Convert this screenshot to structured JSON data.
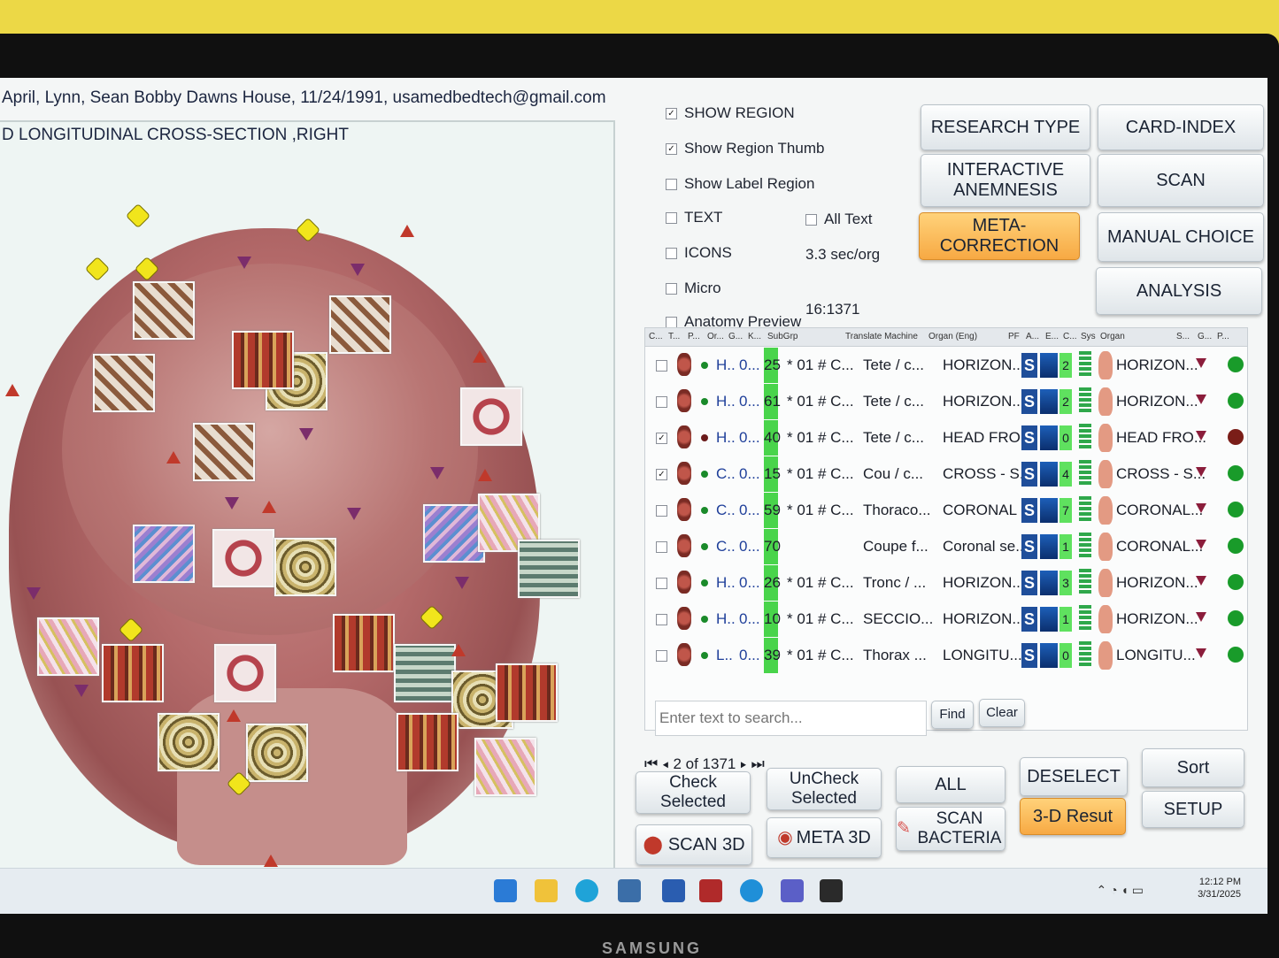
{
  "header": {
    "patient_line": "April, Lynn, Sean Bobby Dawns House, 11/24/1991, usamedbedtech@gmail.com",
    "view_title": "D LONGITUDINAL CROSS-SECTION ,RIGHT"
  },
  "options": {
    "show_region": {
      "label": "SHOW REGION",
      "checked": "✓"
    },
    "show_region_thumb": {
      "label": "Show Region Thumb",
      "checked": "✓"
    },
    "show_label_region": {
      "label": "Show Label Region",
      "checked": ""
    },
    "text": {
      "label": "TEXT",
      "checked": ""
    },
    "all_text": {
      "label": "All Text",
      "checked": ""
    },
    "icons": {
      "label": "ICONS",
      "checked": ""
    },
    "sec_per_org": "3.3  sec/org",
    "micro": {
      "label": "Micro",
      "checked": ""
    },
    "counter": "16:1371",
    "anatomy_preview": {
      "label": "Anatomy Preview",
      "checked": ""
    }
  },
  "buttons": {
    "research_type": "RESEARCH TYPE",
    "card_index": "CARD-INDEX",
    "interactive_anemnesis": "INTERACTIVE ANEMNESIS",
    "scan": "SCAN",
    "meta_correction": "META-CORRECTION",
    "manual_choice": "MANUAL CHOICE",
    "analysis": "ANALYSIS",
    "find": "Find",
    "clear": "Clear",
    "check_selected": "Check Selected",
    "uncheck_selected": "UnCheck Selected",
    "all": "ALL",
    "deselect": "DESELECT",
    "sort": "Sort",
    "scan_3d": "SCAN 3D",
    "meta_3d": "META 3D",
    "scan_bacteria": "SCAN BACTERIA",
    "result_3d": "3-D Resut",
    "setup": "SETUP"
  },
  "grid": {
    "columns": [
      "C...",
      "T...",
      "P...",
      "Or...",
      "G...",
      "K...",
      "SubGrp",
      "Translate Machine",
      "Organ (Eng)",
      "PF",
      "A...",
      "E...",
      "C...",
      "Sys",
      "Organ",
      "S...",
      "G...",
      "P..."
    ],
    "rows": [
      {
        "checked": "",
        "p": "H..",
        "or": "0...",
        "k": "25",
        "subgrp": "* 01 # C...",
        "translate": "Tete / c...",
        "organ_eng": "HORIZON...",
        "pct": "2",
        "organ": "HORIZON...",
        "status": "green"
      },
      {
        "checked": "",
        "p": "H..",
        "or": "0...",
        "k": "61",
        "subgrp": "* 01 # C...",
        "translate": "Tete / c...",
        "organ_eng": "HORIZON...",
        "pct": "2",
        "organ": "HORIZON...",
        "status": "green"
      },
      {
        "checked": "✓",
        "p": "H..",
        "or": "0...",
        "k": "40",
        "subgrp": "* 01 # C...",
        "translate": "Tete / c...",
        "organ_eng": "HEAD FRO...",
        "pct": "0",
        "organ": "HEAD FRO...",
        "status": "red"
      },
      {
        "checked": "✓",
        "p": "C..",
        "or": "0...",
        "k": "15",
        "subgrp": "* 01 # C...",
        "translate": "Cou / c...",
        "organ_eng": "CROSS - S...",
        "pct": "4",
        "organ": "CROSS - S...",
        "status": "green"
      },
      {
        "checked": "",
        "p": "C..",
        "or": "0...",
        "k": "59",
        "subgrp": "* 01 # C...",
        "translate": "Thoraco...",
        "organ_eng": "CORONAL ...",
        "pct": "7",
        "organ": "CORONAL...",
        "status": "green"
      },
      {
        "checked": "",
        "p": "C..",
        "or": "0...",
        "k": "70",
        "subgrp": "",
        "translate": "Coupe f...",
        "organ_eng": "Coronal se...",
        "pct": "1",
        "organ": "CORONAL...",
        "status": "green"
      },
      {
        "checked": "",
        "p": "H..",
        "or": "0...",
        "k": "26",
        "subgrp": "* 01 # C...",
        "translate": "Tronc / ...",
        "organ_eng": "HORIZON...",
        "pct": "3",
        "organ": "HORIZON...",
        "status": "green"
      },
      {
        "checked": "",
        "p": "H..",
        "or": "0...",
        "k": "10",
        "subgrp": "* 01 # C...",
        "translate": "SECCIO...",
        "organ_eng": "HORIZON...",
        "pct": "1",
        "organ": "HORIZON...",
        "status": "green"
      },
      {
        "checked": "",
        "p": "L..",
        "or": "0...",
        "k": "39",
        "subgrp": "* 01 # C...",
        "translate": "Thorax ...",
        "organ_eng": "LONGITU...",
        "pct": "0",
        "organ": "LONGITU...",
        "status": "green"
      }
    ]
  },
  "search": {
    "placeholder": "Enter text to search..."
  },
  "pager": {
    "text": "2 of 1371"
  },
  "taskbar": {
    "time": "12:12 PM",
    "date": "3/31/2025"
  },
  "monitor": {
    "brand": "SAMSUNG"
  },
  "colors": {
    "accent_orange": "#f7a943",
    "status_green": "#199b2a",
    "status_red": "#7a1d18",
    "highlight_green": "#49d44b"
  }
}
